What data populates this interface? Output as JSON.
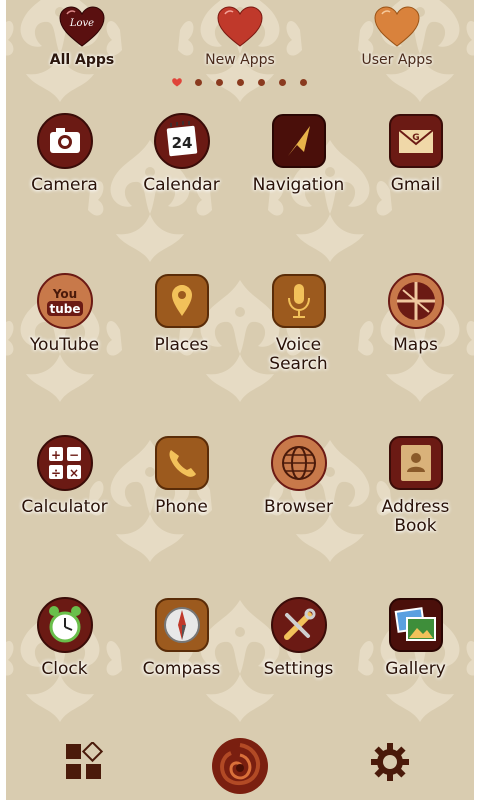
{
  "tabs": [
    {
      "label": "All Apps",
      "heart_text": "Love",
      "color": "#5a1010",
      "active": true
    },
    {
      "label": "New Apps",
      "color": "#c0392b",
      "active": false
    },
    {
      "label": "User Apps",
      "color": "#d9823c",
      "active": false
    }
  ],
  "page_indicator": {
    "count": 7,
    "current": 1
  },
  "apps": [
    {
      "label": "Camera",
      "icon": "camera-icon"
    },
    {
      "label": "Calendar",
      "icon": "calendar-icon",
      "day": "24"
    },
    {
      "label": "Navigation",
      "icon": "navigation-icon"
    },
    {
      "label": "Gmail",
      "icon": "gmail-icon",
      "letter": "G"
    },
    {
      "label": "YouTube",
      "icon": "youtube-icon",
      "line1": "You",
      "line2": "tube"
    },
    {
      "label": "Places",
      "icon": "places-icon"
    },
    {
      "label": "Voice\nSearch",
      "label1": "Voice",
      "label2": "Search",
      "icon": "microphone-icon"
    },
    {
      "label": "Maps",
      "icon": "maps-icon"
    },
    {
      "label": "Calculator",
      "icon": "calculator-icon"
    },
    {
      "label": "Phone",
      "icon": "phone-icon"
    },
    {
      "label": "Browser",
      "icon": "globe-icon"
    },
    {
      "label": "Address\nBook",
      "label1": "Address",
      "label2": "Book",
      "icon": "address-book-icon"
    },
    {
      "label": "Clock",
      "icon": "alarm-clock-icon"
    },
    {
      "label": "Compass",
      "icon": "compass-icon"
    },
    {
      "label": "Settings",
      "icon": "tools-icon"
    },
    {
      "label": "Gallery",
      "icon": "gallery-icon"
    }
  ],
  "dock": [
    {
      "name": "app-drawer-icon"
    },
    {
      "name": "rose-icon"
    },
    {
      "name": "gear-icon"
    }
  ],
  "colors": {
    "background": "#d9ccb0",
    "damask": "#efe6d2",
    "icon_dark_red": "#6b1a14",
    "icon_brown": "#9c5a1e",
    "label_text": "#2a1208"
  }
}
